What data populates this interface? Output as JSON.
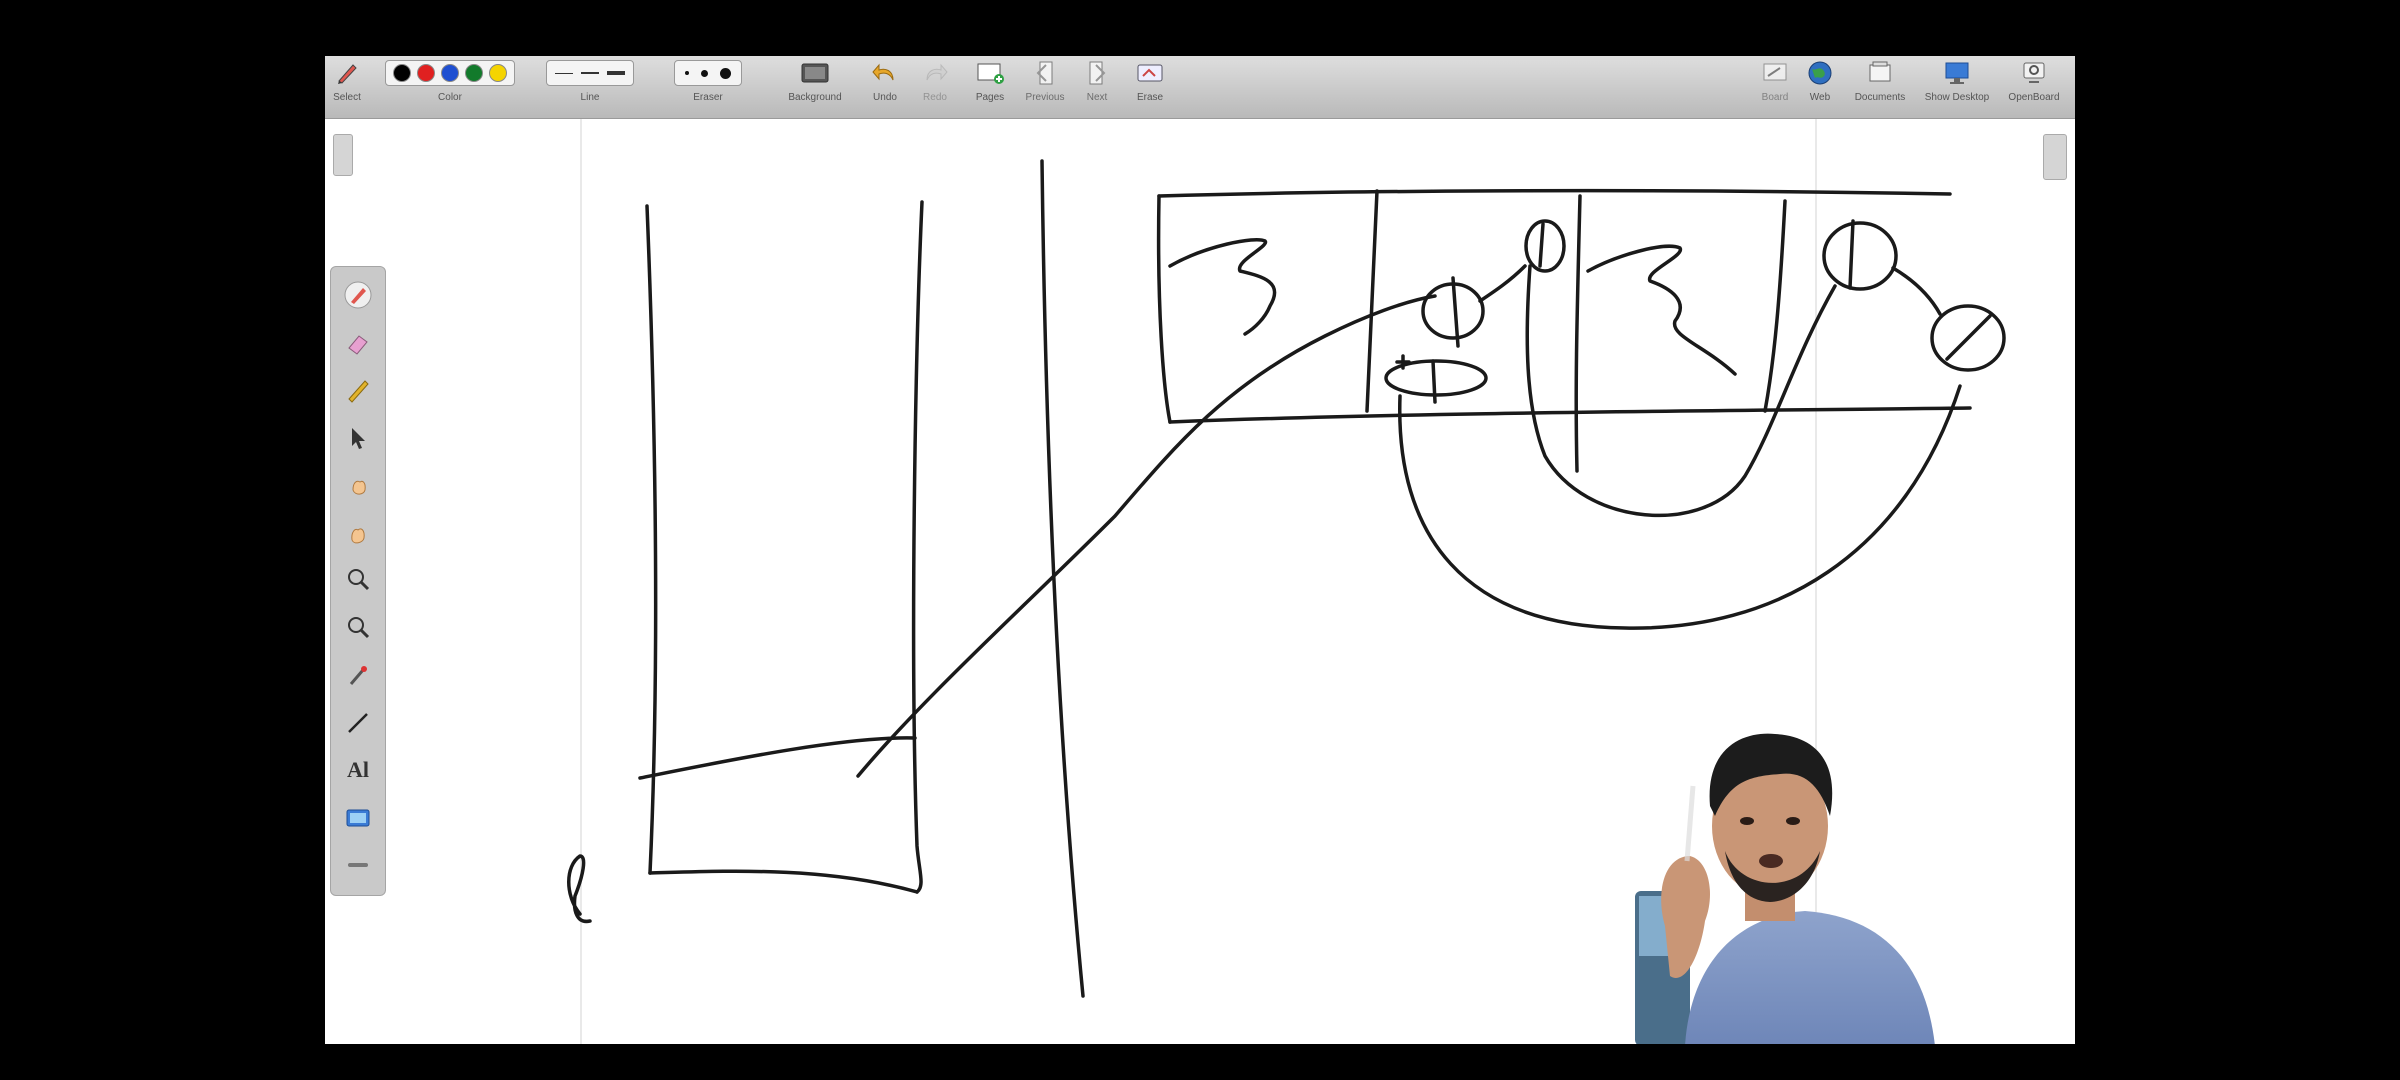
{
  "toolbar": {
    "left_groups": [
      {
        "id": "select",
        "label": "Select"
      },
      {
        "id": "color",
        "label": "Color"
      },
      {
        "id": "line",
        "label": "Line"
      },
      {
        "id": "eraser",
        "label": "Eraser"
      },
      {
        "id": "background",
        "label": "Background"
      },
      {
        "id": "undo",
        "label": "Undo"
      },
      {
        "id": "redo",
        "label": "Redo"
      },
      {
        "id": "pages",
        "label": "Pages"
      },
      {
        "id": "previous",
        "label": "Previous"
      },
      {
        "id": "next",
        "label": "Next"
      },
      {
        "id": "erase",
        "label": "Erase"
      }
    ],
    "right_groups": [
      {
        "id": "board",
        "label": "Board"
      },
      {
        "id": "web",
        "label": "Web"
      },
      {
        "id": "documents",
        "label": "Documents"
      },
      {
        "id": "show_desktop",
        "label": "Show Desktop"
      },
      {
        "id": "openboard",
        "label": "OpenBoard"
      }
    ],
    "colors": [
      "#000000",
      "#e02020",
      "#1e4fd1",
      "#127a2b",
      "#f5d400"
    ]
  },
  "side_tools": [
    {
      "icon": "pen-icon"
    },
    {
      "icon": "eraser-icon"
    },
    {
      "icon": "marker-icon"
    },
    {
      "icon": "selector-icon"
    },
    {
      "icon": "interact-icon"
    },
    {
      "icon": "hand-icon"
    },
    {
      "icon": "zoom-in-icon"
    },
    {
      "icon": "zoom-out-icon"
    },
    {
      "icon": "laser-icon"
    },
    {
      "icon": "line-icon"
    },
    {
      "icon": "text-icon",
      "text": "Al"
    },
    {
      "icon": "capture-icon"
    },
    {
      "icon": "more-icon"
    }
  ],
  "canvas_annotations": {
    "left_label": "l"
  }
}
